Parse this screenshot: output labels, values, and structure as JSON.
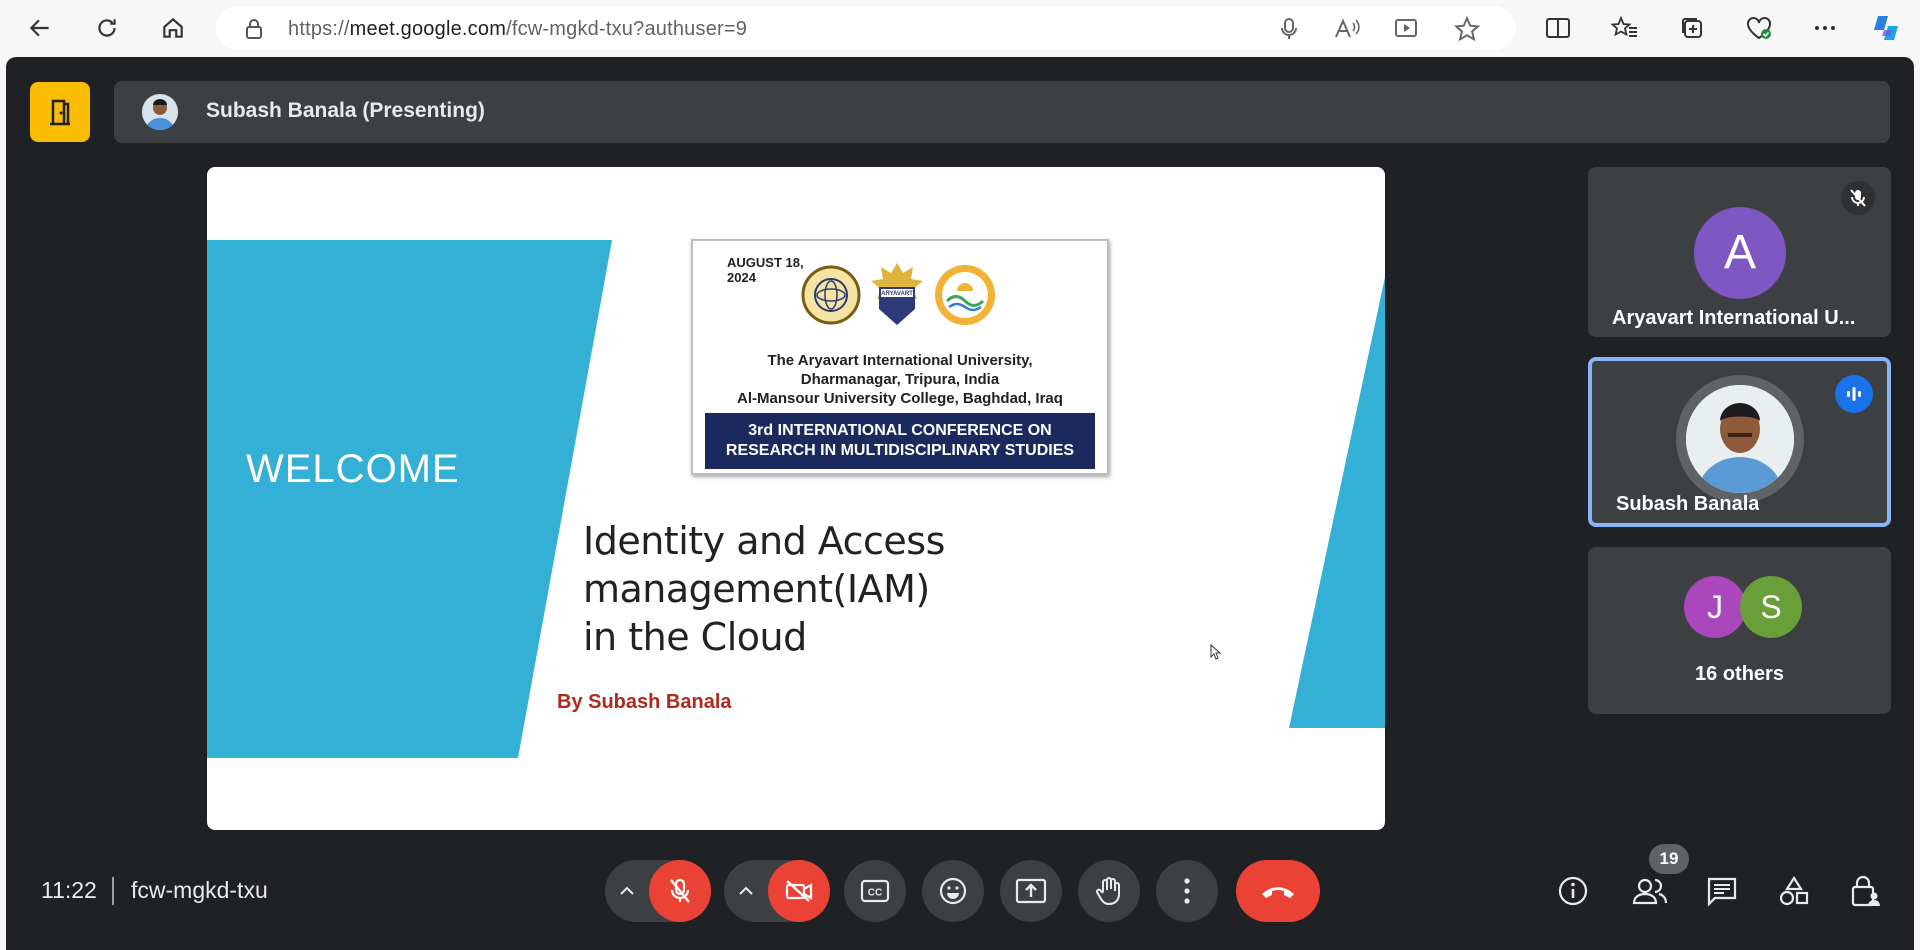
{
  "browser": {
    "url_prefix": "https://",
    "url_host": "meet.google.com",
    "url_path": "/fcw-mgkd-txu?authuser=9"
  },
  "meeting": {
    "presenter_label": "Subash Banala (Presenting)",
    "time": "11:22",
    "code": "fcw-mgkd-txu",
    "participant_count": "19"
  },
  "slide": {
    "welcome": "WELCOME",
    "date_line1": "AUGUST 18,",
    "date_line2": "2024",
    "university_line1": "The Aryavart International University,",
    "university_line2": "Dharmanagar, Tripura, India",
    "university_line3": "Al-Mansour University College, Baghdad, Iraq",
    "conference_line1": "3rd INTERNATIONAL CONFERENCE ON",
    "conference_line2": "RESEARCH IN MULTIDISCIPLINARY STUDIES",
    "seal_text": "ARYAVART",
    "title_line1": "Identity and Access management(IAM)",
    "title_line2": "in the Cloud",
    "byline": "By Subash Banala",
    "accent_color": "#34afd6"
  },
  "participants": [
    {
      "name": "Aryavart International U...",
      "initial": "A",
      "color": "#7e57c2",
      "muted": true
    },
    {
      "name": "Subash Banala",
      "speaking": true
    },
    {
      "others_label": "16 others",
      "initials": [
        "J",
        "S"
      ],
      "colors": [
        "#ab47bc",
        "#689f38"
      ]
    }
  ],
  "controls": {
    "mic": "muted",
    "camera": "off",
    "captions": "CC"
  }
}
